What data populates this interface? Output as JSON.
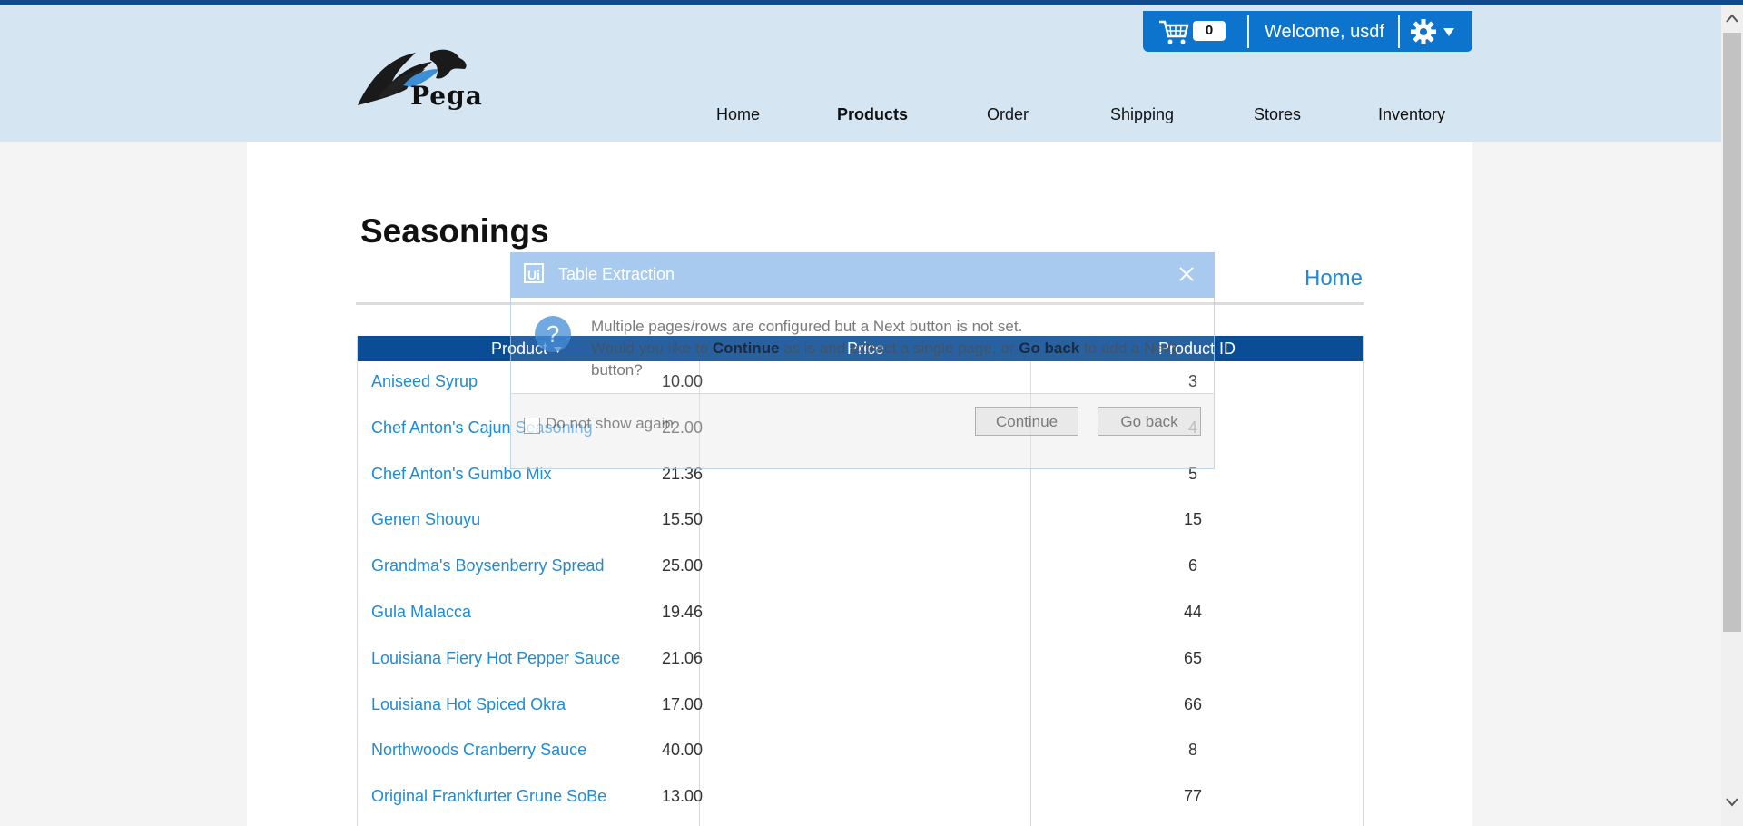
{
  "header": {
    "logo_text": "Pega",
    "cart_count": "0",
    "welcome": "Welcome, usdf",
    "nav": [
      {
        "label": "Home"
      },
      {
        "label": "Products"
      },
      {
        "label": "Order"
      },
      {
        "label": "Shipping"
      },
      {
        "label": "Stores"
      },
      {
        "label": "Inventory"
      }
    ],
    "active_nav": "Products"
  },
  "page": {
    "title": "Seasonings",
    "home_link": "Home"
  },
  "table": {
    "columns": [
      "Product",
      "Price",
      "Product ID"
    ],
    "rows": [
      {
        "product": "Aniseed Syrup",
        "price": "10.00",
        "id": "3"
      },
      {
        "product": "Chef Anton's Cajun Seasoning",
        "price": "22.00",
        "id": "4"
      },
      {
        "product": "Chef Anton's Gumbo Mix",
        "price": "21.36",
        "id": "5"
      },
      {
        "product": "Genen Shouyu",
        "price": "15.50",
        "id": "15"
      },
      {
        "product": "Grandma's Boysenberry Spread",
        "price": "25.00",
        "id": "6"
      },
      {
        "product": "Gula Malacca",
        "price": "19.46",
        "id": "44"
      },
      {
        "product": "Louisiana Fiery Hot Pepper Sauce",
        "price": "21.06",
        "id": "65"
      },
      {
        "product": "Louisiana Hot Spiced Okra",
        "price": "17.00",
        "id": "66"
      },
      {
        "product": "Northwoods Cranberry Sauce",
        "price": "40.00",
        "id": "8"
      },
      {
        "product": "Original Frankfurter Grune SoBe",
        "price": "13.00",
        "id": "77"
      }
    ]
  },
  "dialog": {
    "icon_text": "Ui",
    "title": "Table Extraction",
    "line1": "Multiple pages/rows are configured but a Next button is not set.",
    "line2_a": "Would you like to ",
    "line2_b": "Continue",
    "line2_c": " as is and extract a single page, or ",
    "line2_d": "Go back",
    "line2_e": " to add a Next button?",
    "checkbox_label": "Do not show again",
    "continue_label": "Continue",
    "goback_label": "Go back"
  },
  "colors": {
    "accent": "#0c74cd",
    "table_header": "#0b4c96",
    "link": "#1f8ad6"
  }
}
